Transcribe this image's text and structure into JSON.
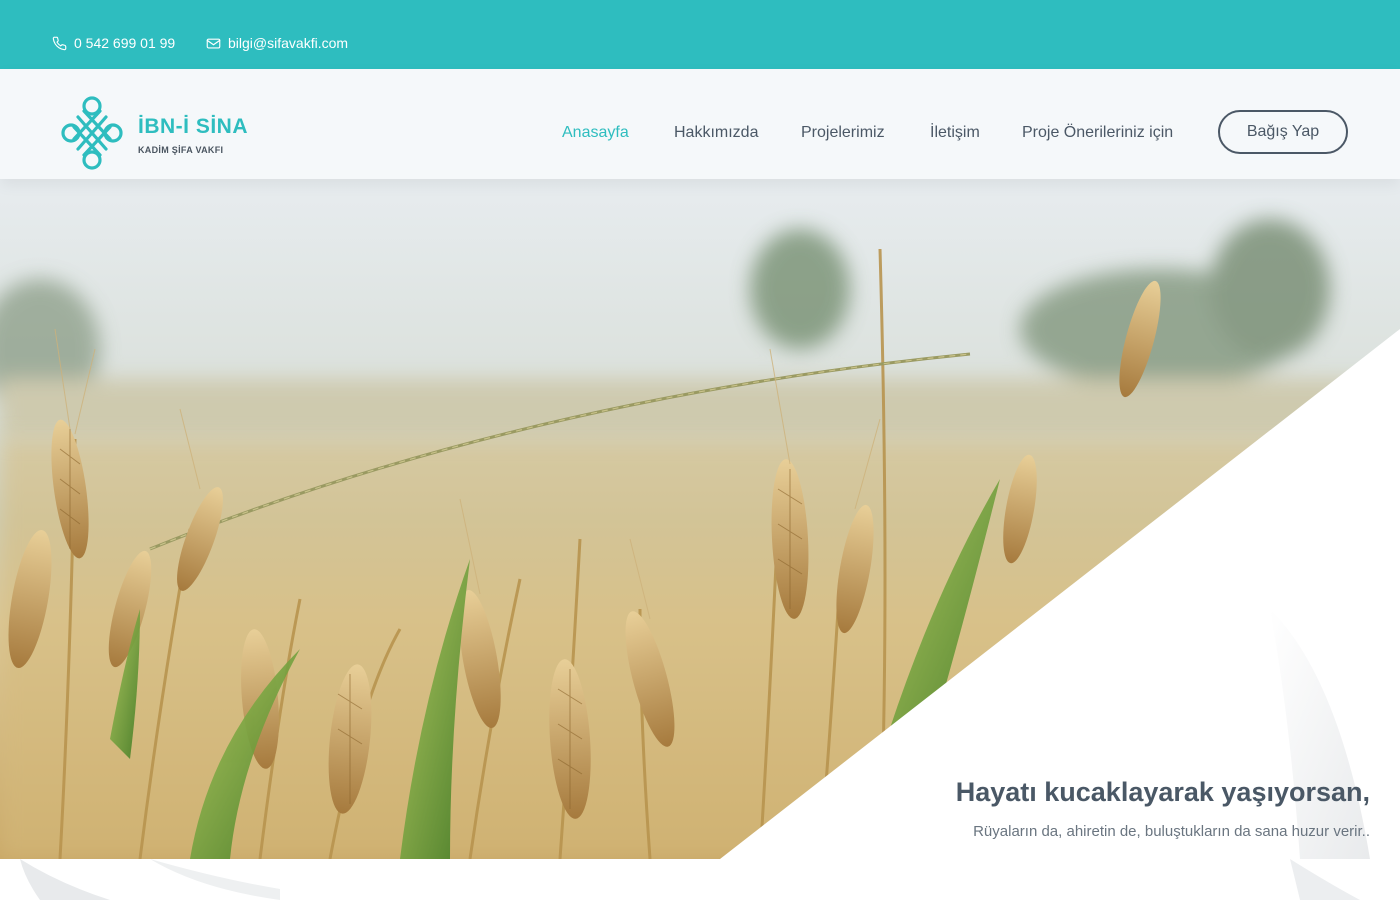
{
  "topbar": {
    "phone": "0 542 699 01 99",
    "email": "bilgi@sifavakfi.com",
    "phone_icon": "phone-icon",
    "email_icon": "mail-icon"
  },
  "brand": {
    "title": "İBN-İ SİNA",
    "subtitle": "KADİM ŞİFA VAKFI",
    "logo_icon": "knot-logo-icon"
  },
  "nav": {
    "items": [
      {
        "label": "Anasayfa",
        "active": true
      },
      {
        "label": "Hakkımızda",
        "active": false
      },
      {
        "label": "Projelerimiz",
        "active": false
      },
      {
        "label": "İletişim",
        "active": false
      },
      {
        "label": "Proje Önerileriniz için",
        "active": false
      }
    ],
    "donate_label": "Bağış Yap"
  },
  "hero": {
    "title": "Hayatı kucaklayarak yaşıyorsan,",
    "subtitle": "Rüyaların da, ahiretin de, buluştukların da sana huzur verir.."
  },
  "colors": {
    "accent": "#2ebdbf",
    "text_dark": "#4b5866",
    "header_bg": "#f5f8fa"
  }
}
